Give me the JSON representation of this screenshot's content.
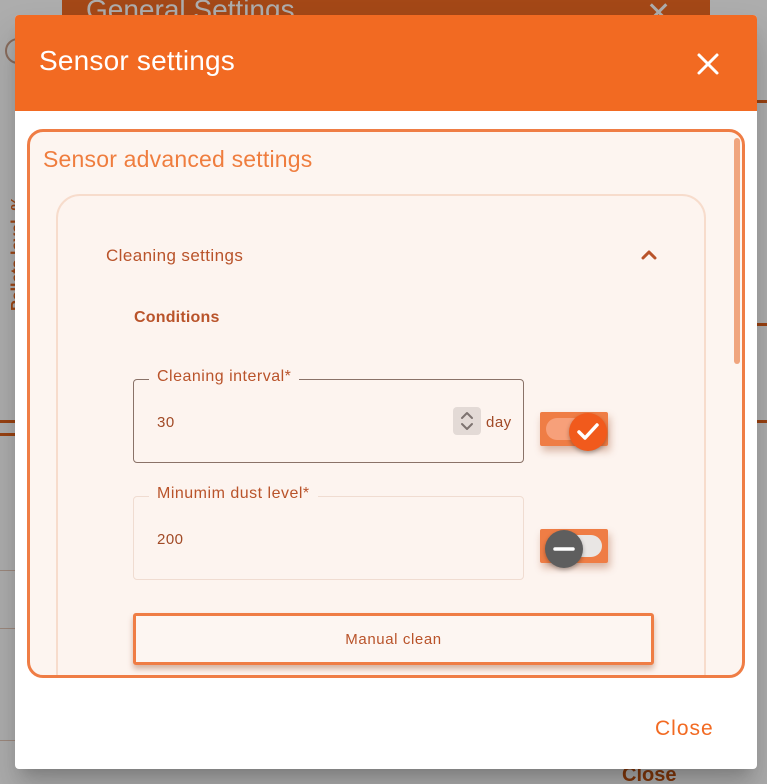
{
  "background": {
    "dialog_title": "General Settings",
    "close_label": "Close",
    "y_axis_label": "Pellets level, %"
  },
  "dialog": {
    "title": "Sensor settings",
    "close_label": "Close"
  },
  "panel": {
    "title": "Sensor advanced settings",
    "section": {
      "title": "Cleaning settings",
      "expanded": true,
      "subheading": "Conditions",
      "fields": [
        {
          "label": "Cleaning interval*",
          "value": "30",
          "unit": "day",
          "toggle_on": true
        },
        {
          "label": "Minumim dust level*",
          "value": "200",
          "toggle_on": false
        }
      ],
      "action_label": "Manual clean"
    }
  },
  "colors": {
    "accent": "#f26a22",
    "panel_border": "#ef7d45",
    "text_brown": "#b9532a",
    "panel_bg": "#fdf5f0"
  },
  "icons": {
    "close": "close-icon",
    "collapse": "chevron-up-icon",
    "spinner": "spinner-arrows-icon",
    "check": "check-icon",
    "minus": "minus-icon"
  }
}
